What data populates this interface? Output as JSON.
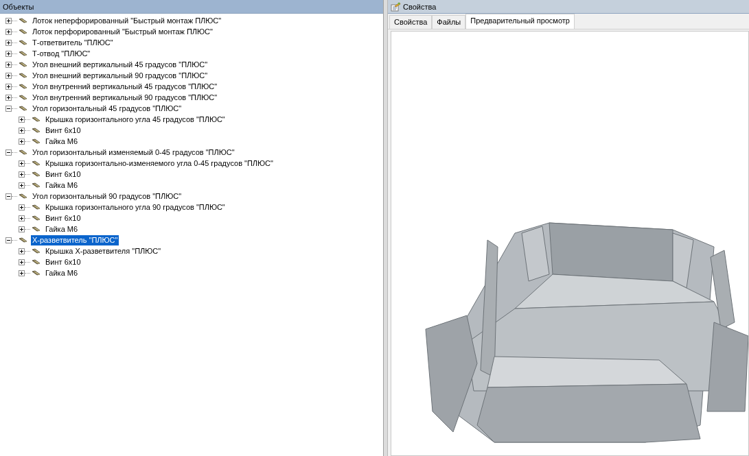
{
  "objects_panel": {
    "title": "Объекты",
    "tree": [
      {
        "label": "Лоток неперфорированный \"Быстрый монтаж ПЛЮС\"",
        "expanded": false,
        "selected": false
      },
      {
        "label": "Лоток перфорированный \"Быстрый монтаж ПЛЮС\"",
        "expanded": false,
        "selected": false
      },
      {
        "label": "Т-ответвитель \"ПЛЮС\"",
        "expanded": false,
        "selected": false
      },
      {
        "label": "Т-отвод \"ПЛЮС\"",
        "expanded": false,
        "selected": false
      },
      {
        "label": "Угол внешний вертикальный 45 градусов \"ПЛЮС\"",
        "expanded": false,
        "selected": false
      },
      {
        "label": "Угол внешний вертикальный 90 градусов \"ПЛЮС\"",
        "expanded": false,
        "selected": false
      },
      {
        "label": "Угол внутренний вертикальный 45 градусов \"ПЛЮС\"",
        "expanded": false,
        "selected": false
      },
      {
        "label": "Угол внутренний вертикальный 90 градусов \"ПЛЮС\"",
        "expanded": false,
        "selected": false
      },
      {
        "label": "Угол горизонтальный 45 градусов \"ПЛЮС\"",
        "expanded": true,
        "selected": false,
        "children": [
          {
            "label": "Крышка горизонтального угла 45 градусов \"ПЛЮС\"",
            "expanded": false,
            "selected": false
          },
          {
            "label": "Винт 6x10",
            "expanded": false,
            "selected": false
          },
          {
            "label": "Гайка М6",
            "expanded": false,
            "selected": false
          }
        ]
      },
      {
        "label": "Угол горизонтальный изменяемый 0-45 градусов \"ПЛЮС\"",
        "expanded": true,
        "selected": false,
        "children": [
          {
            "label": "Крышка горизонтально-изменяемого угла 0-45 градусов \"ПЛЮС\"",
            "expanded": false,
            "selected": false
          },
          {
            "label": "Винт 6x10",
            "expanded": false,
            "selected": false
          },
          {
            "label": "Гайка М6",
            "expanded": false,
            "selected": false
          }
        ]
      },
      {
        "label": "Угол горизонтальный 90 градусов \"ПЛЮС\"",
        "expanded": true,
        "selected": false,
        "children": [
          {
            "label": "Крышка горизонтального угла 90 градусов \"ПЛЮС\"",
            "expanded": false,
            "selected": false
          },
          {
            "label": "Винт 6x10",
            "expanded": false,
            "selected": false
          },
          {
            "label": "Гайка М6",
            "expanded": false,
            "selected": false
          }
        ]
      },
      {
        "label": "X-разветвитель \"ПЛЮС\"",
        "expanded": true,
        "selected": true,
        "children": [
          {
            "label": "Крышка X-разветвителя \"ПЛЮС\"",
            "expanded": false,
            "selected": false
          },
          {
            "label": "Винт 6x10",
            "expanded": false,
            "selected": false
          },
          {
            "label": "Гайка М6",
            "expanded": false,
            "selected": false
          }
        ]
      }
    ]
  },
  "properties_panel": {
    "title": "Свойства",
    "tabs": [
      {
        "label": "Свойства",
        "selected": false
      },
      {
        "label": "Файлы",
        "selected": false
      },
      {
        "label": "Предварительный просмотр",
        "selected": true
      }
    ]
  }
}
